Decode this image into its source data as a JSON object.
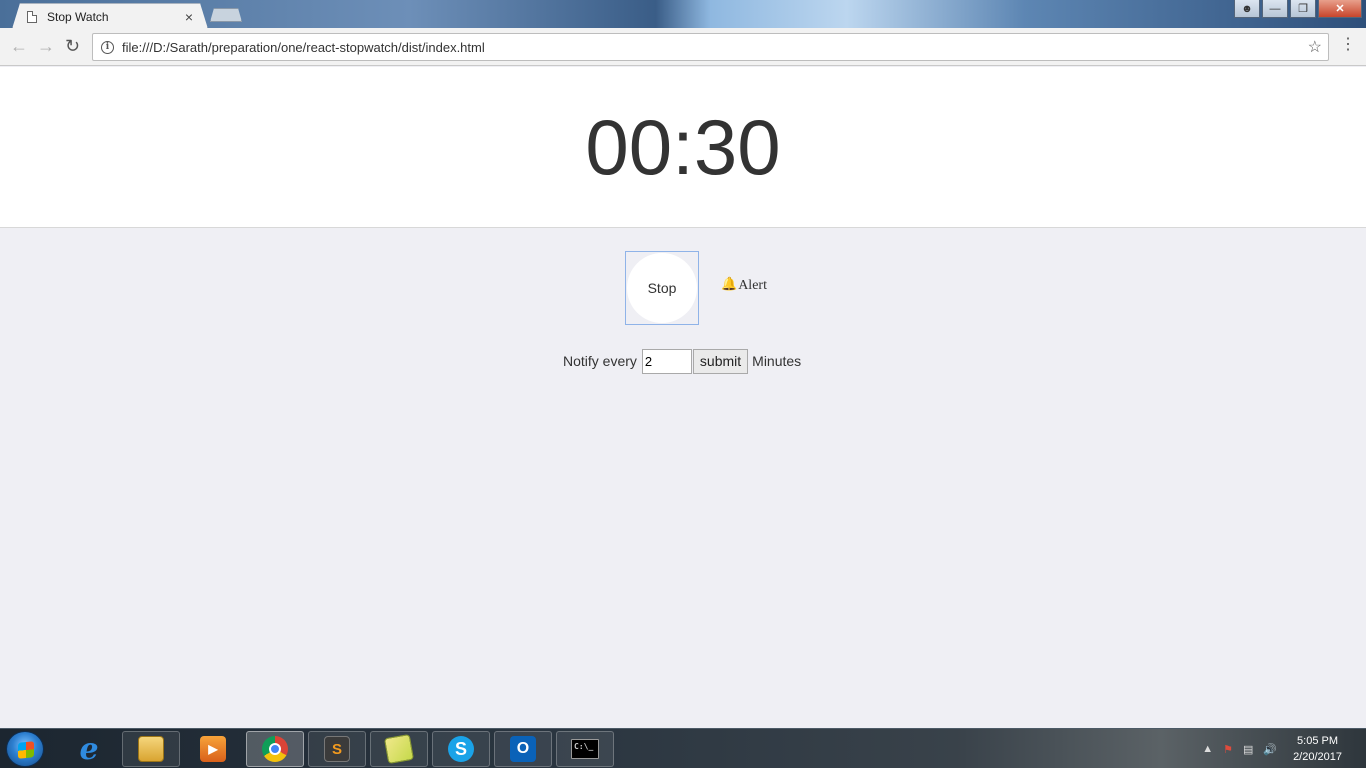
{
  "browser": {
    "tab_title": "Stop Watch",
    "tab_close": "×",
    "url": "file:///D:/Sarath/preparation/one/react-stopwatch/dist/index.html",
    "window_buttons": [
      "minimize",
      "restore",
      "close"
    ]
  },
  "stopwatch": {
    "time": "00:30",
    "stop_label": "Stop",
    "alert_label": "Alert"
  },
  "notify": {
    "prefix": "Notify every",
    "value": "2",
    "submit_label": "submit",
    "suffix": "Minutes"
  },
  "taskbar": {
    "apps": [
      "internet-explorer",
      "windows-explorer",
      "media-player",
      "google-chrome",
      "sublime-text",
      "sticky-notes",
      "skype",
      "outlook",
      "command-prompt"
    ],
    "active_app": "google-chrome",
    "clock_time": "5:05 PM",
    "clock_date": "2/20/2017"
  },
  "colors": {
    "page_background": "#efeff4",
    "timer_text": "#333333",
    "focus_outline": "#8fb3e8"
  }
}
